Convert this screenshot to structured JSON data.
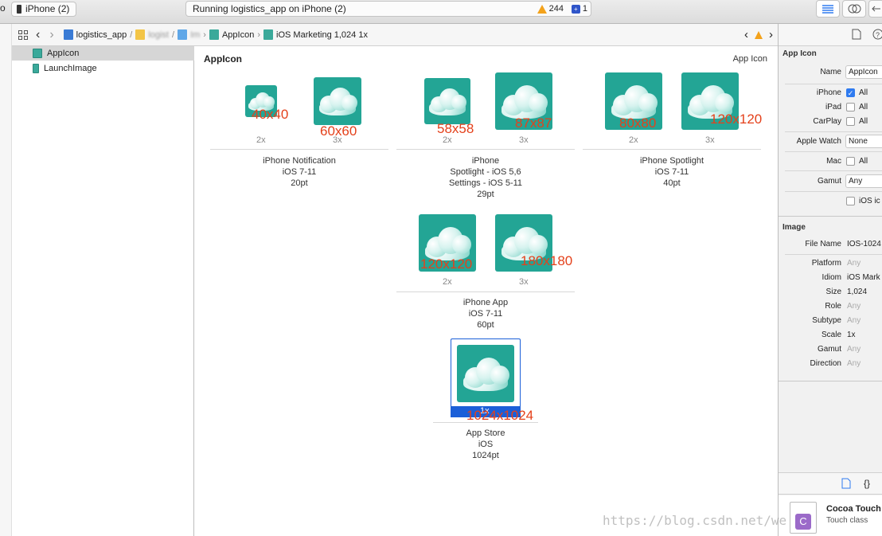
{
  "toolbar": {
    "scheme_fragment": "o",
    "device": "iPhone (2)",
    "status": "Running logistics_app on iPhone (2)",
    "warning_count": "244",
    "issue_count": "1"
  },
  "jumpbar": {
    "crumbs": [
      "logistics_app",
      "logist",
      "Im",
      "AppIcon",
      "iOS Marketing 1,024 1x"
    ]
  },
  "navigator": {
    "items": [
      "AppIcon",
      "LaunchImage"
    ]
  },
  "editor": {
    "title": "AppIcon",
    "kind": "App Icon",
    "slots": [
      {
        "size": "40x40",
        "scale": "2x"
      },
      {
        "size": "60x60",
        "scale": "3x"
      },
      {
        "size": "58x58",
        "scale": "2x"
      },
      {
        "size": "87x87",
        "scale": "3x"
      },
      {
        "size": "80x80",
        "scale": "2x"
      },
      {
        "size": "120x120",
        "scale": "3x"
      },
      {
        "size": "120x120",
        "scale": "2x"
      },
      {
        "size": "180x180",
        "scale": "3x"
      },
      {
        "size": "1024x1024",
        "scale": "1x"
      }
    ],
    "groups": [
      {
        "l1": "iPhone Notification",
        "l2": "iOS 7-11",
        "l3": "20pt",
        "l4": ""
      },
      {
        "l1": "iPhone",
        "l2": "Spotlight - iOS 5,6",
        "l3": "Settings - iOS 5-11",
        "l4": "29pt"
      },
      {
        "l1": "iPhone Spotlight",
        "l2": "iOS 7-11",
        "l3": "40pt",
        "l4": ""
      },
      {
        "l1": "iPhone App",
        "l2": "iOS 7-11",
        "l3": "60pt",
        "l4": ""
      },
      {
        "l1": "App Store",
        "l2": "iOS",
        "l3": "1024pt",
        "l4": ""
      }
    ]
  },
  "inspector": {
    "section_app_icon": "App Icon",
    "name_label": "Name",
    "name_value": "AppIcon",
    "iphone_label": "iPhone",
    "ipad_label": "iPad",
    "carplay_label": "CarPlay",
    "all_label": "All",
    "watch_label": "Apple Watch",
    "watch_value": "None",
    "mac_label": "Mac",
    "gamut_label": "Gamut",
    "gamut_value": "Any",
    "ios_icon_label": "iOS ic",
    "section_image": "Image",
    "file_name_label": "File Name",
    "file_name_value": "IOS-1024",
    "props": [
      {
        "label": "Platform",
        "value": "Any",
        "dim": true
      },
      {
        "label": "Idiom",
        "value": "iOS Mark",
        "dim": false
      },
      {
        "label": "Size",
        "value": "1,024",
        "dim": false
      },
      {
        "label": "Role",
        "value": "Any",
        "dim": true
      },
      {
        "label": "Subtype",
        "value": "Any",
        "dim": true
      },
      {
        "label": "Scale",
        "value": "1x",
        "dim": false
      },
      {
        "label": "Gamut",
        "value": "Any",
        "dim": true
      },
      {
        "label": "Direction",
        "value": "Any",
        "dim": true
      }
    ],
    "library_title": "Cocoa Touch",
    "library_subtitle": "Touch class",
    "code_tab": "{}"
  },
  "watermark": "https://blog.csdn.net/we",
  "colors": {
    "icon_teal": "#23a595",
    "size_label": "#e4411b",
    "selection": "#1b5fd8"
  }
}
